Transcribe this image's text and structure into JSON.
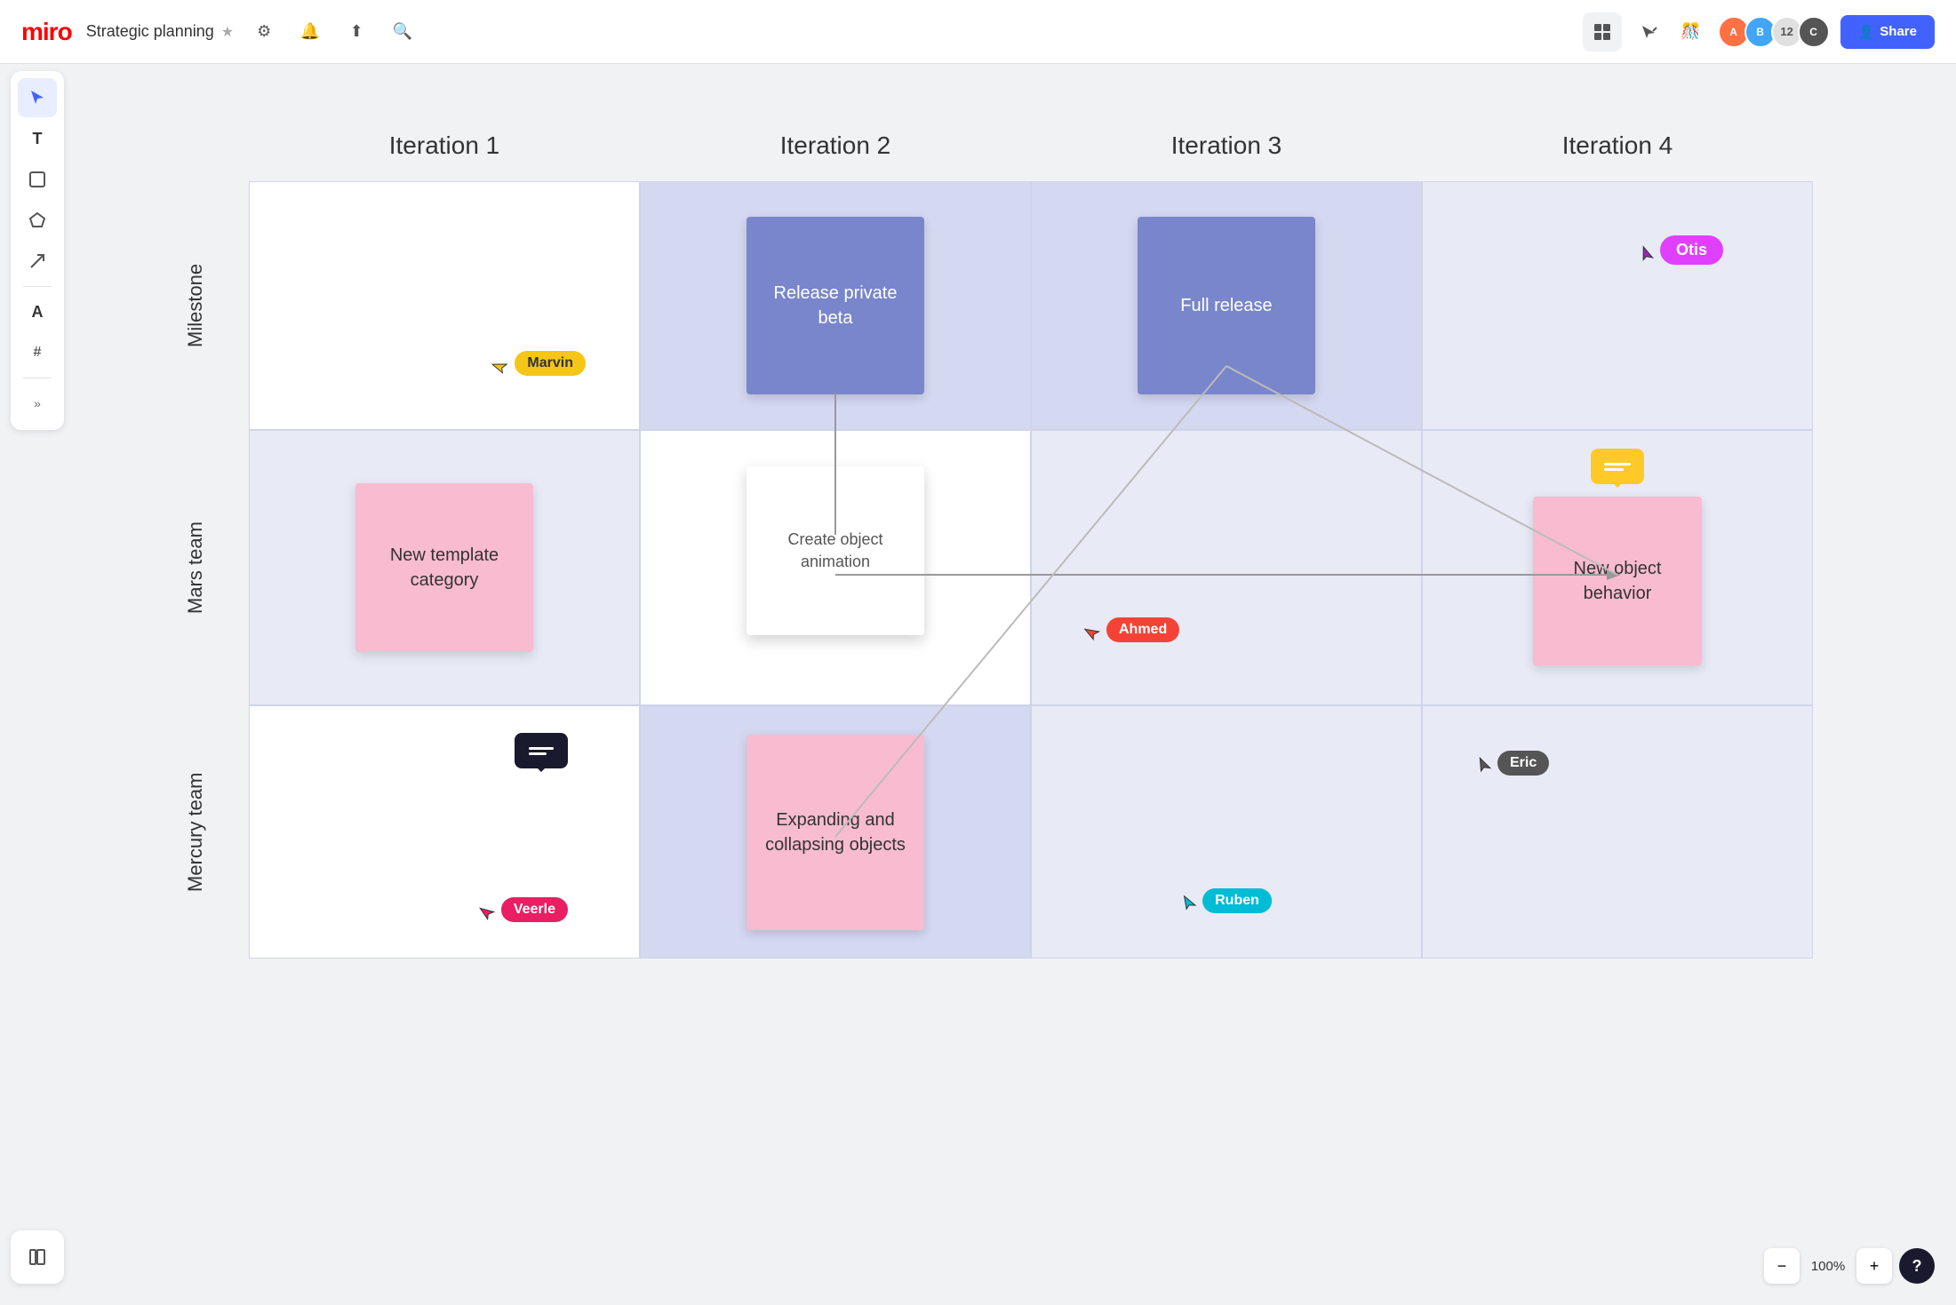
{
  "topbar": {
    "logo": "miro",
    "board_title": "Strategic planning",
    "star_label": "★",
    "share_label": "Share",
    "zoom_level": "100%",
    "help_label": "?"
  },
  "toolbar": {
    "select_tool": "▲",
    "text_tool": "T",
    "note_tool": "◻",
    "shapes_tool": "⬡",
    "arrow_tool": "↗",
    "pen_tool": "A",
    "frame_tool": "#",
    "more_label": "»",
    "undo_label": "↩",
    "redo_label": "↪"
  },
  "columns": [
    "Iteration 1",
    "Iteration 2",
    "Iteration 3",
    "Iteration 4"
  ],
  "rows": [
    "Milestone",
    "Mars team",
    "Mercury team"
  ],
  "cards": {
    "release_private_beta": "Release private beta",
    "full_release": "Full release",
    "new_template_category": "New template category",
    "create_object_animation": "Create object animation",
    "new_object_behavior": "New object behavior",
    "expanding_collapsing": "Expanding and collapsing objects"
  },
  "users": {
    "marvin": "Marvin",
    "ahmed": "Ahmed",
    "veerle": "Veerle",
    "ruben": "Ruben",
    "eric": "Eric",
    "otis": "Otis"
  },
  "bottom_bar": {
    "zoom_out": "−",
    "zoom_in": "+",
    "zoom_level": "100%",
    "help": "?"
  }
}
